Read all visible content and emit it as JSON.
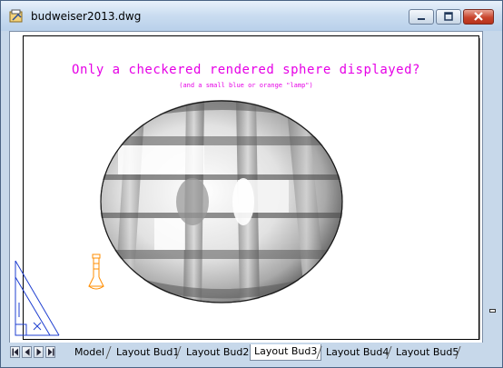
{
  "window": {
    "title": "budweiser2013.dwg",
    "buttons": {
      "minimize": "minimize-icon",
      "maximize": "maximize-icon",
      "close": "close-icon"
    }
  },
  "drawing": {
    "message_main": "Only a checkered rendered sphere displayed?",
    "message_sub": "(and a small blue or orange \"lamp\")",
    "colors": {
      "message": "#e600e6",
      "lamp": "#ff8c00",
      "ucs": "#1f3fd0"
    }
  },
  "tabs": [
    {
      "label": "Model"
    },
    {
      "label": "Layout Bud1"
    },
    {
      "label": "Layout Bud2"
    },
    {
      "label": "Layout Bud3",
      "active": true
    },
    {
      "label": "Layout Bud4"
    },
    {
      "label": "Layout Bud5"
    }
  ],
  "tab_navigation": [
    "first-tab-icon",
    "previous-tab-icon",
    "next-tab-icon",
    "last-tab-icon"
  ]
}
